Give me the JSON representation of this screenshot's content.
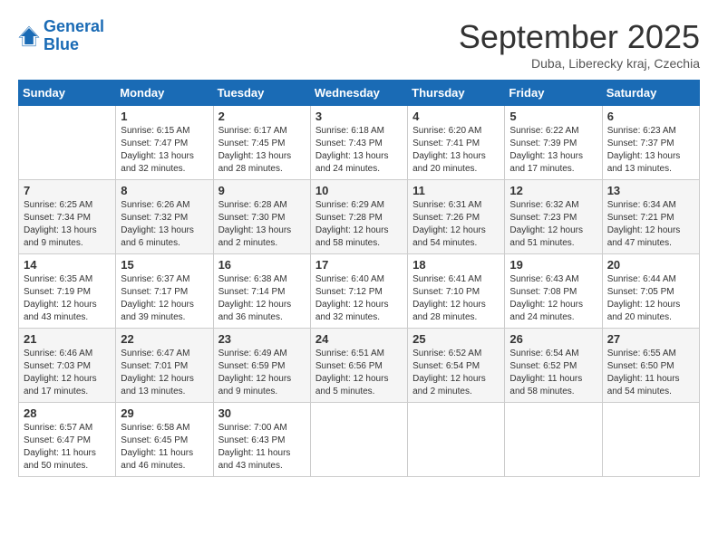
{
  "header": {
    "logo_line1": "General",
    "logo_line2": "Blue",
    "month": "September 2025",
    "location": "Duba, Liberecky kraj, Czechia"
  },
  "days_of_week": [
    "Sunday",
    "Monday",
    "Tuesday",
    "Wednesday",
    "Thursday",
    "Friday",
    "Saturday"
  ],
  "weeks": [
    [
      {
        "day": "",
        "text": ""
      },
      {
        "day": "1",
        "text": "Sunrise: 6:15 AM\nSunset: 7:47 PM\nDaylight: 13 hours\nand 32 minutes."
      },
      {
        "day": "2",
        "text": "Sunrise: 6:17 AM\nSunset: 7:45 PM\nDaylight: 13 hours\nand 28 minutes."
      },
      {
        "day": "3",
        "text": "Sunrise: 6:18 AM\nSunset: 7:43 PM\nDaylight: 13 hours\nand 24 minutes."
      },
      {
        "day": "4",
        "text": "Sunrise: 6:20 AM\nSunset: 7:41 PM\nDaylight: 13 hours\nand 20 minutes."
      },
      {
        "day": "5",
        "text": "Sunrise: 6:22 AM\nSunset: 7:39 PM\nDaylight: 13 hours\nand 17 minutes."
      },
      {
        "day": "6",
        "text": "Sunrise: 6:23 AM\nSunset: 7:37 PM\nDaylight: 13 hours\nand 13 minutes."
      }
    ],
    [
      {
        "day": "7",
        "text": "Sunrise: 6:25 AM\nSunset: 7:34 PM\nDaylight: 13 hours\nand 9 minutes."
      },
      {
        "day": "8",
        "text": "Sunrise: 6:26 AM\nSunset: 7:32 PM\nDaylight: 13 hours\nand 6 minutes."
      },
      {
        "day": "9",
        "text": "Sunrise: 6:28 AM\nSunset: 7:30 PM\nDaylight: 13 hours\nand 2 minutes."
      },
      {
        "day": "10",
        "text": "Sunrise: 6:29 AM\nSunset: 7:28 PM\nDaylight: 12 hours\nand 58 minutes."
      },
      {
        "day": "11",
        "text": "Sunrise: 6:31 AM\nSunset: 7:26 PM\nDaylight: 12 hours\nand 54 minutes."
      },
      {
        "day": "12",
        "text": "Sunrise: 6:32 AM\nSunset: 7:23 PM\nDaylight: 12 hours\nand 51 minutes."
      },
      {
        "day": "13",
        "text": "Sunrise: 6:34 AM\nSunset: 7:21 PM\nDaylight: 12 hours\nand 47 minutes."
      }
    ],
    [
      {
        "day": "14",
        "text": "Sunrise: 6:35 AM\nSunset: 7:19 PM\nDaylight: 12 hours\nand 43 minutes."
      },
      {
        "day": "15",
        "text": "Sunrise: 6:37 AM\nSunset: 7:17 PM\nDaylight: 12 hours\nand 39 minutes."
      },
      {
        "day": "16",
        "text": "Sunrise: 6:38 AM\nSunset: 7:14 PM\nDaylight: 12 hours\nand 36 minutes."
      },
      {
        "day": "17",
        "text": "Sunrise: 6:40 AM\nSunset: 7:12 PM\nDaylight: 12 hours\nand 32 minutes."
      },
      {
        "day": "18",
        "text": "Sunrise: 6:41 AM\nSunset: 7:10 PM\nDaylight: 12 hours\nand 28 minutes."
      },
      {
        "day": "19",
        "text": "Sunrise: 6:43 AM\nSunset: 7:08 PM\nDaylight: 12 hours\nand 24 minutes."
      },
      {
        "day": "20",
        "text": "Sunrise: 6:44 AM\nSunset: 7:05 PM\nDaylight: 12 hours\nand 20 minutes."
      }
    ],
    [
      {
        "day": "21",
        "text": "Sunrise: 6:46 AM\nSunset: 7:03 PM\nDaylight: 12 hours\nand 17 minutes."
      },
      {
        "day": "22",
        "text": "Sunrise: 6:47 AM\nSunset: 7:01 PM\nDaylight: 12 hours\nand 13 minutes."
      },
      {
        "day": "23",
        "text": "Sunrise: 6:49 AM\nSunset: 6:59 PM\nDaylight: 12 hours\nand 9 minutes."
      },
      {
        "day": "24",
        "text": "Sunrise: 6:51 AM\nSunset: 6:56 PM\nDaylight: 12 hours\nand 5 minutes."
      },
      {
        "day": "25",
        "text": "Sunrise: 6:52 AM\nSunset: 6:54 PM\nDaylight: 12 hours\nand 2 minutes."
      },
      {
        "day": "26",
        "text": "Sunrise: 6:54 AM\nSunset: 6:52 PM\nDaylight: 11 hours\nand 58 minutes."
      },
      {
        "day": "27",
        "text": "Sunrise: 6:55 AM\nSunset: 6:50 PM\nDaylight: 11 hours\nand 54 minutes."
      }
    ],
    [
      {
        "day": "28",
        "text": "Sunrise: 6:57 AM\nSunset: 6:47 PM\nDaylight: 11 hours\nand 50 minutes."
      },
      {
        "day": "29",
        "text": "Sunrise: 6:58 AM\nSunset: 6:45 PM\nDaylight: 11 hours\nand 46 minutes."
      },
      {
        "day": "30",
        "text": "Sunrise: 7:00 AM\nSunset: 6:43 PM\nDaylight: 11 hours\nand 43 minutes."
      },
      {
        "day": "",
        "text": ""
      },
      {
        "day": "",
        "text": ""
      },
      {
        "day": "",
        "text": ""
      },
      {
        "day": "",
        "text": ""
      }
    ]
  ]
}
